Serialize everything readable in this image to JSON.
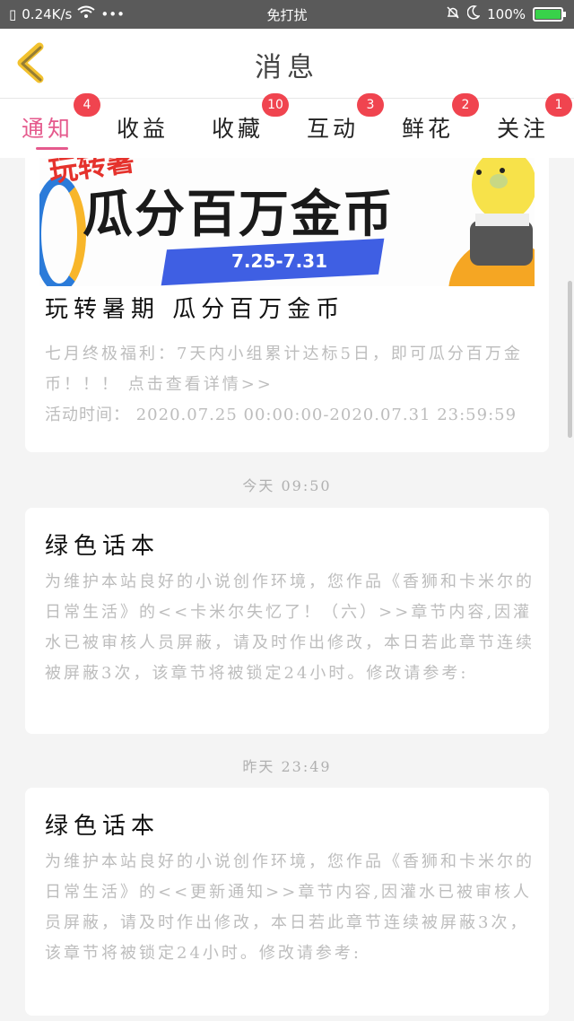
{
  "statusbar": {
    "speed": "0.24K/s",
    "dots": "•••",
    "center_text": "免打扰",
    "battery": "100%",
    "battery_level": 1.0
  },
  "header": {
    "title": "消息"
  },
  "tabs": [
    {
      "label": "通知",
      "badge": "4"
    },
    {
      "label": "收益",
      "badge": ""
    },
    {
      "label": "收藏",
      "badge": "10"
    },
    {
      "label": "互动",
      "badge": "3"
    },
    {
      "label": "鲜花",
      "badge": "2"
    },
    {
      "label": "关注",
      "badge": "1"
    }
  ],
  "messages": [
    {
      "banner_top": "玩转暑",
      "banner_title": "瓜分百万金币",
      "banner_date": "7.25-7.31",
      "title": "玩转暑期 瓜分百万金币",
      "body": "七月终极福利：7天内小组累计达标5日，即可瓜分百万金币！！！ 点击查看详情>>",
      "body2": "活动时间： 2020.07.25 00:00:00-2020.07.31 23:59:59"
    },
    {
      "time": "今天 09:50",
      "title": "绿色话本",
      "body": "为维护本站良好的小说创作环境，您作品《香狮和卡米尔的日常生活》的<<卡米尔失忆了！（六）>>章节内容,因灌水已被审核人员屏蔽，请及时作出修改，本日若此章节连续被屏蔽3次，该章节将被锁定24小时。修改请参考:"
    },
    {
      "time": "昨天 23:49",
      "title": "绿色话本",
      "body": "为维护本站良好的小说创作环境，您作品《香狮和卡米尔的日常生活》的<<更新通知>>章节内容,因灌水已被审核人员屏蔽，请及时作出修改，本日若此章节连续被屏蔽3次，该章节将被锁定24小时。修改请参考:"
    }
  ],
  "colors": {
    "accent": "#e55a8d",
    "badge": "#f0444f",
    "back_arrow": "#f2c12e"
  }
}
